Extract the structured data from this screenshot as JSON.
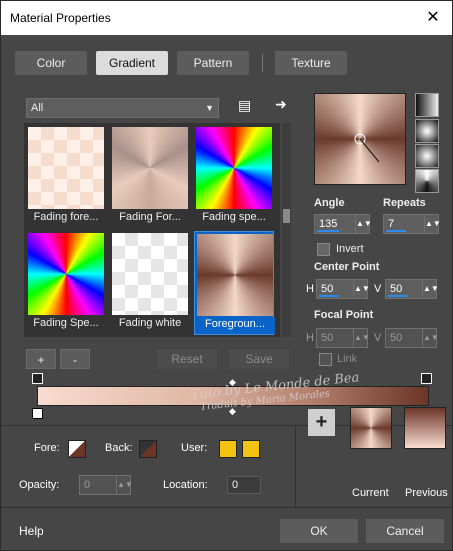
{
  "window": {
    "title": "Material Properties",
    "close": "✕"
  },
  "tabs": [
    {
      "label": "Color"
    },
    {
      "label": "Gradient"
    },
    {
      "label": "Pattern"
    },
    {
      "label": "Texture"
    }
  ],
  "filter": {
    "selected": "All"
  },
  "gradients": [
    {
      "label": "Fading fore..."
    },
    {
      "label": "Fading For..."
    },
    {
      "label": "Fading spe..."
    },
    {
      "label": "Fading Spe..."
    },
    {
      "label": "Fading white"
    },
    {
      "label": "Foregroun..."
    }
  ],
  "buttons": {
    "add": "+",
    "remove": "-",
    "reset": "Reset",
    "save": "Save",
    "link": "Link"
  },
  "settings": {
    "angle_label": "Angle",
    "angle": "135",
    "repeats_label": "Repeats",
    "repeats": "7",
    "invert_label": "Invert",
    "center_label": "Center Point",
    "center_h": "50",
    "center_v": "50",
    "focal_label": "Focal Point",
    "focal_h": "50",
    "focal_v": "50",
    "h": "H",
    "v": "V"
  },
  "colors": {
    "fore_label": "Fore:",
    "back_label": "Back:",
    "user_label": "User:",
    "opacity_label": "Opacity:",
    "opacity": "0",
    "location_label": "Location:",
    "location": "0",
    "current_label": "Current",
    "previous_label": "Previous"
  },
  "watermark": [
    "Tuto by Le Monde de Bea",
    "Traduit by Maria Morales"
  ],
  "footer": {
    "help": "Help",
    "ok": "OK",
    "cancel": "Cancel"
  }
}
